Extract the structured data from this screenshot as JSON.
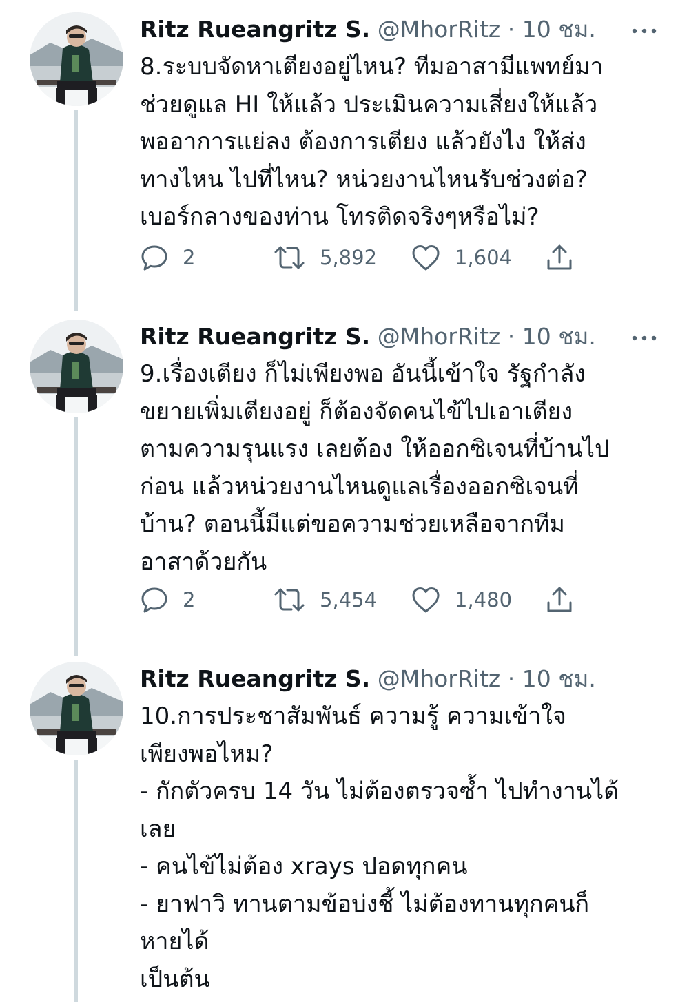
{
  "tweets": [
    {
      "display_name": "Ritz Rueangritz S.",
      "handle": "@MhorRitz",
      "separator": "·",
      "time": "10 ชม.",
      "text": "8.ระบบจัดหาเตียงอยู่ไหน? ทีมอาสามีแพทย์มา\nช่วยดูแล HI ให้แล้ว ประเมินความเสี่ยงให้แล้ว\nพออาการแย่ลง ต้องการเตียง แล้วยังไง ให้ส่ง\nทางไหน ไปที่ไหน? หน่วยงานไหนรับช่วงต่อ?\nเบอร์กลางของท่าน โทรติดจริงๆหรือไม่?",
      "replies": "2",
      "retweets": "5,892",
      "likes": "1,604"
    },
    {
      "display_name": "Ritz Rueangritz S.",
      "handle": "@MhorRitz",
      "separator": "·",
      "time": "10 ชม.",
      "text": "9.เรื่องเตียง ก็ไม่เพียงพอ อันนี้เข้าใจ รัฐกำลัง\nขยายเพิ่มเตียงอยู่ ก็ต้องจัดคนไข้ไปเอาเตียง\nตามความรุนแรง เลยต้อง ให้ออกซิเจนที่บ้านไป\nก่อน แล้วหน่วยงานไหนดูแลเรื่องออกซิเจนที่\nบ้าน? ตอนนี้มีแต่ขอความช่วยเหลือจากทีม\nอาสาด้วยกัน",
      "replies": "2",
      "retweets": "5,454",
      "likes": "1,480"
    },
    {
      "display_name": "Ritz Rueangritz S.",
      "handle": "@MhorRitz",
      "separator": "·",
      "time": "10 ชม.",
      "text": "10.การประชาสัมพันธ์ ความรู้ ความเข้าใจ\nเพียงพอไหม?\n- กักตัวครบ 14 วัน ไม่ต้องตรวจซ้ำ ไปทำงานได้\nเลย\n- คนไข้ไม่ต้อง xrays ปอดทุกคน\n- ยาฟาวิ ทานตามข้อบ่งชี้ ไม่ต้องทานทุกคนก็\nหายได้\nเป็นต้น"
    }
  ],
  "icons": {
    "reply": "reply-icon",
    "retweet": "retweet-icon",
    "like": "heart-icon",
    "share": "share-icon",
    "more": "more-icon",
    "avatar": "avatar-image"
  },
  "colors": {
    "text_primary": "#0f1419",
    "text_secondary": "#536471",
    "thread_line": "#cfd9de"
  }
}
